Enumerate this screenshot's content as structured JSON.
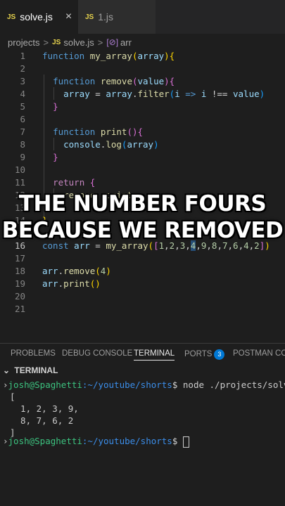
{
  "tabs": [
    {
      "icon": "JS",
      "label": "solve.js",
      "close": "×"
    },
    {
      "icon": "JS",
      "label": "1.js"
    }
  ],
  "breadcrumb": {
    "folder": "projects",
    "sep": ">",
    "file_icon": "JS",
    "file": "solve.js",
    "symbol_icon": "[⊘]",
    "symbol": "arr"
  },
  "editor": {
    "line_numbers": [
      "1",
      "2",
      "3",
      "4",
      "5",
      "6",
      "7",
      "8",
      "9",
      "10",
      "11",
      "12",
      "13",
      "14",
      "15",
      "16",
      "17",
      "18",
      "19",
      "20",
      "21"
    ],
    "current_line": 16,
    "lines": {
      "l1_kw": "function",
      "l1_fn": "my_array",
      "l1_param": "array",
      "l3_kw": "function",
      "l3_fn": "remove",
      "l3_param": "value",
      "l4_var": "array",
      "l4_eq": " = ",
      "l4_obj": "array",
      "l4_method": "filter",
      "l4_arg": "i",
      "l4_arrow": " => ",
      "l4_i": "i",
      "l4_op": " !== ",
      "l4_val": "value",
      "l7_kw": "function",
      "l7_fn": "print",
      "l8_obj": "console",
      "l8_method": "log",
      "l8_arg": "array",
      "l11_kw": "return",
      "l12_text": "remove, print",
      "l16_kw": "const",
      "l16_var": "arr",
      "l16_eq": " = ",
      "l16_fn": "my_array",
      "l16_nums": [
        "1",
        "2",
        "3",
        "4",
        "9",
        "8",
        "7",
        "6",
        "4",
        "2"
      ],
      "l18_obj": "arr",
      "l18_method": "remove",
      "l18_arg": "4",
      "l19_obj": "arr",
      "l19_method": "print"
    }
  },
  "overlay": {
    "line1": "THE NUMBER FOURS",
    "line2": "BECAUSE WE REMOVED"
  },
  "panel": {
    "tabs": [
      "PROBLEMS",
      "DEBUG CONSOLE",
      "TERMINAL",
      "PORTS",
      "POSTMAN CON"
    ],
    "ports_badge": "3",
    "active_tab": "TERMINAL"
  },
  "terminal": {
    "header": "TERMINAL",
    "user": "josh@Spaghetti",
    "path": ":~/youtube/shorts",
    "prompt_symbol": "$",
    "command": "node ./projects/solve.",
    "output": [
      "[",
      "  1, 2, 3, 9,",
      "  8, 7, 6, 2",
      "]"
    ],
    "user2": "josh@Spaghetti",
    "path2": ":~/youtube/shorts",
    "prompt2": "$"
  }
}
